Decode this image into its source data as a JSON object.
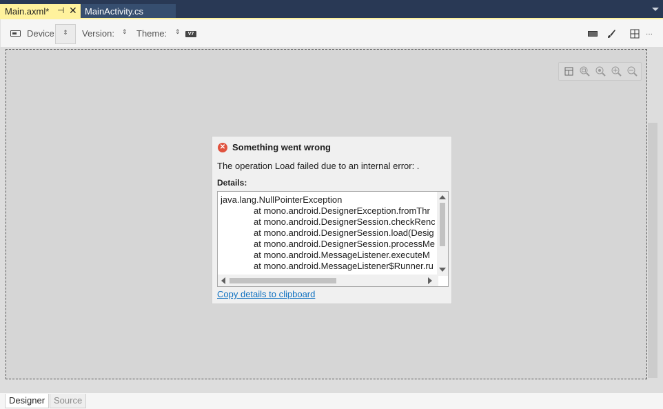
{
  "tabs": {
    "active": {
      "label": "Main.axml*",
      "pin_icon": "pin-icon",
      "close_icon": "close-icon"
    },
    "inactive": {
      "label": "MainActivity.cs"
    }
  },
  "toolbar": {
    "device_label": "Device:",
    "version_label": "Version:",
    "theme_label": "Theme:",
    "theme_badge": "V7",
    "spinner_glyph": "⇕",
    "overflow_glyph": "···"
  },
  "zoom_toolbar": {
    "icons": [
      "layout-icon",
      "zoom-fit-icon",
      "zoom-actual-icon",
      "zoom-in-icon",
      "zoom-out-icon"
    ]
  },
  "dialog": {
    "title": "Something went wrong",
    "message": "The operation Load failed due to an internal error: .",
    "details_label": "Details:",
    "details_lines": [
      "java.lang.NullPointerException",
      "at mono.android.DesignerException.fromThr",
      "at mono.android.DesignerSession.checkRenc",
      "at mono.android.DesignerSession.load(Desig",
      "at mono.android.DesignerSession.processMe",
      "at mono.android.MessageListener.executeM",
      "at mono.android.MessageListener$Runner.ru"
    ],
    "copy_link": "Copy details to clipboard"
  },
  "bottom_tabs": {
    "designer": "Designer",
    "source": "Source"
  },
  "colors": {
    "tab_active_bg": "#fff29d",
    "titlebar_bg": "#293955",
    "error_red": "#e0523e",
    "link_blue": "#0e70c0"
  }
}
